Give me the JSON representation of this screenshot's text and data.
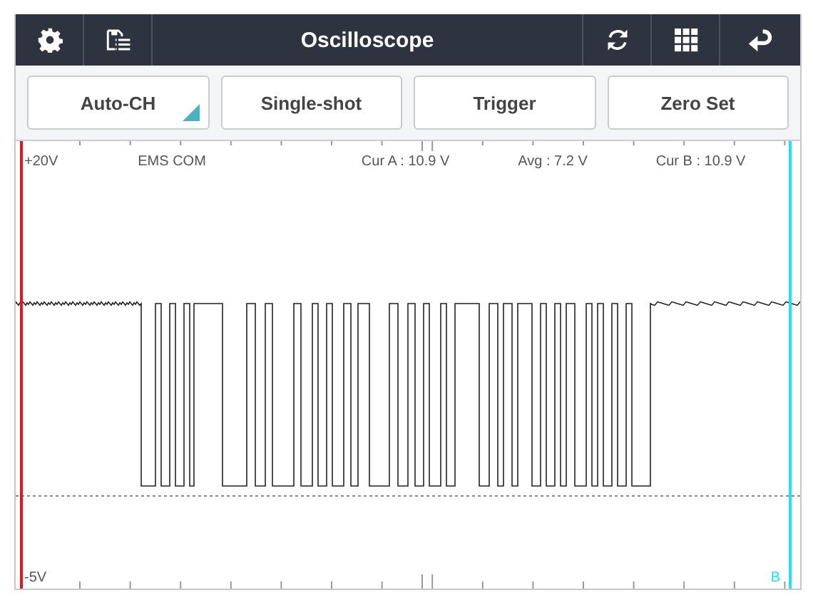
{
  "window": {
    "title": "Oscilloscope"
  },
  "buttons": [
    {
      "label": "Auto-CH",
      "kind": "menu"
    },
    {
      "label": "Single-shot",
      "kind": "plain"
    },
    {
      "label": "Trigger",
      "kind": "plain"
    },
    {
      "label": "Zero Set",
      "kind": "plain"
    }
  ],
  "scope": {
    "range_top": "+20V",
    "channel": "EMS COM",
    "readouts": [
      "Cur A : 10.9 V",
      "Avg : 7.2 V",
      "Cur B : 10.9 V"
    ],
    "range_bottom": "-5V",
    "cursor_b_label": "B"
  }
}
